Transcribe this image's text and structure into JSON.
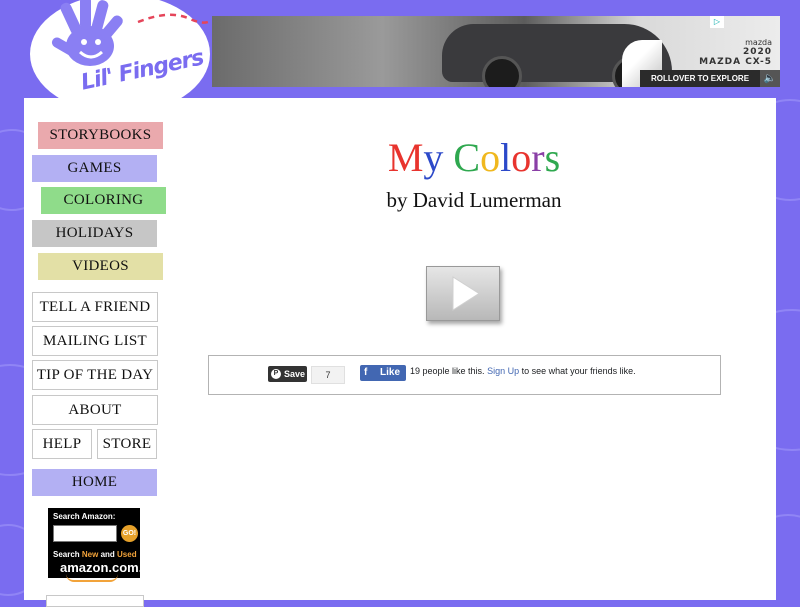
{
  "brand": {
    "logo_text": "Lil' Fingers"
  },
  "ad": {
    "model_year": "2020",
    "model_name": "MAZDA CX-5",
    "brand_name": "mazda",
    "rollover_label": "ROLLOVER TO EXPLORE",
    "choice_glyph": "▷",
    "sound_glyph": "🔈"
  },
  "colors": {
    "background": "#7a6cf0",
    "storybooks": "#eaa9ad",
    "games": "#b3b0f3",
    "coloring": "#8fdc8a",
    "holidays": "#c6c6c6",
    "videos": "#e3e0a6",
    "home": "#b3b0f3"
  },
  "nav": {
    "storybooks": "STORYBOOKS",
    "games": "GAMES",
    "coloring": "COLORING",
    "holidays": "HOLIDAYS",
    "videos": "VIDEOS",
    "tell_a_friend": "TELL A FRIEND",
    "mailing_list": "MAILING LIST",
    "tip_of_the_day": "TIP OF THE DAY",
    "about": "ABOUT",
    "help": "HELP",
    "store": "STORE",
    "home": "HOME"
  },
  "amazon": {
    "search_label": "Search Amazon:",
    "go_label": "GO!",
    "tagline_prefix": "Search ",
    "tagline_new": "New",
    "tagline_mid": " and ",
    "tagline_used": "Used",
    "logo_text": "amazon.com."
  },
  "main": {
    "title_letters": [
      {
        "char": "M",
        "color": "#e8342e"
      },
      {
        "char": "y",
        "color": "#2c49c9"
      },
      {
        "char": " ",
        "color": "#000000"
      },
      {
        "char": "C",
        "color": "#2fa84f"
      },
      {
        "char": "o",
        "color": "#f0b81e"
      },
      {
        "char": "l",
        "color": "#2c49c9"
      },
      {
        "char": "o",
        "color": "#e8342e"
      },
      {
        "char": "r",
        "color": "#8a3fa6"
      },
      {
        "char": "s",
        "color": "#2fa84f"
      }
    ],
    "byline": "by David Lumerman"
  },
  "social": {
    "pin_glyph": "P",
    "pin_save": "Save",
    "pin_count": "7",
    "fb_glyph": "f",
    "fb_like": "Like",
    "fb_count_text": "19 people like this.",
    "fb_signup": "Sign Up",
    "fb_tail": "to see what your friends like."
  }
}
